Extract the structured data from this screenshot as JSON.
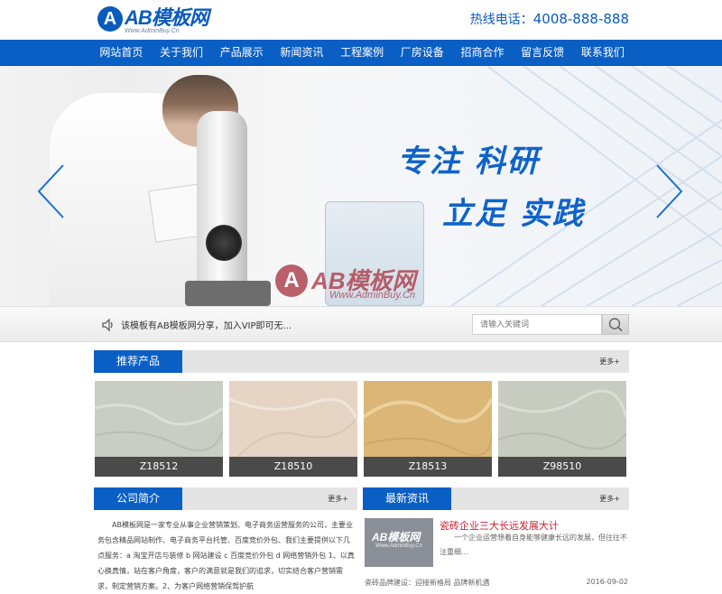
{
  "header": {
    "logo_mark": "A",
    "logo_text": "AB模板网",
    "logo_sub": "Www.AdminBuy.Cn",
    "hotline_label": "热线电话：",
    "hotline_number": "4008-888-888"
  },
  "nav": {
    "items": [
      "网站首页",
      "关于我们",
      "产品展示",
      "新闻资讯",
      "工程案例",
      "厂房设备",
      "招商合作",
      "留言反馈",
      "联系我们"
    ]
  },
  "banner": {
    "slogan_line1": "专注 科研",
    "slogan_line2": "立足 实践",
    "watermark_mark": "A",
    "watermark_text": "AB模板网",
    "watermark_sub": "Www.AdminBuy.Cn"
  },
  "notice": {
    "text": "该模板有AB模板网分享，加入VIP即可无...",
    "search_placeholder": "请输入关键词"
  },
  "products": {
    "title": "推荐产品",
    "more": "更多+",
    "items": [
      {
        "name": "Z18512",
        "color": "#c9cdc3"
      },
      {
        "name": "Z18510",
        "color": "#e6d4c4"
      },
      {
        "name": "Z18513",
        "color": "#dbb676"
      },
      {
        "name": "Z98510",
        "color": "#c8ccc0"
      }
    ]
  },
  "about": {
    "title": "公司简介",
    "more": "更多+",
    "text": "AB模板网是一家专业从事企业营销策划、电子商务运营服务的公司，主要业务包含精品网站制作、电子商务平台托管、百度竞价外包、我们主要提供以下几点服务：a 淘宝开店与装修 b 网站建设 c 百度竞价外包 d 网络营销外包 1、以真心换真情，站在客户角度，客户的满意就是我们的追求，切实结合客户营销需求，制定营销方案。2、为客户网络营销保驾护航"
  },
  "news": {
    "title": "最新资讯",
    "more": "更多+",
    "thumb_text": "AB模板网",
    "thumb_sub": "Www.AdminBuy.Cn",
    "headline": "瓷砖企业三大长远发展大计",
    "summary": "一个企业运营想着自身能够健康长远的发展，但往往不注重细...",
    "rows": [
      {
        "title": "瓷砖品牌建设：迎接新格局 品牌新机遇",
        "date": "2016-09-02"
      }
    ]
  }
}
